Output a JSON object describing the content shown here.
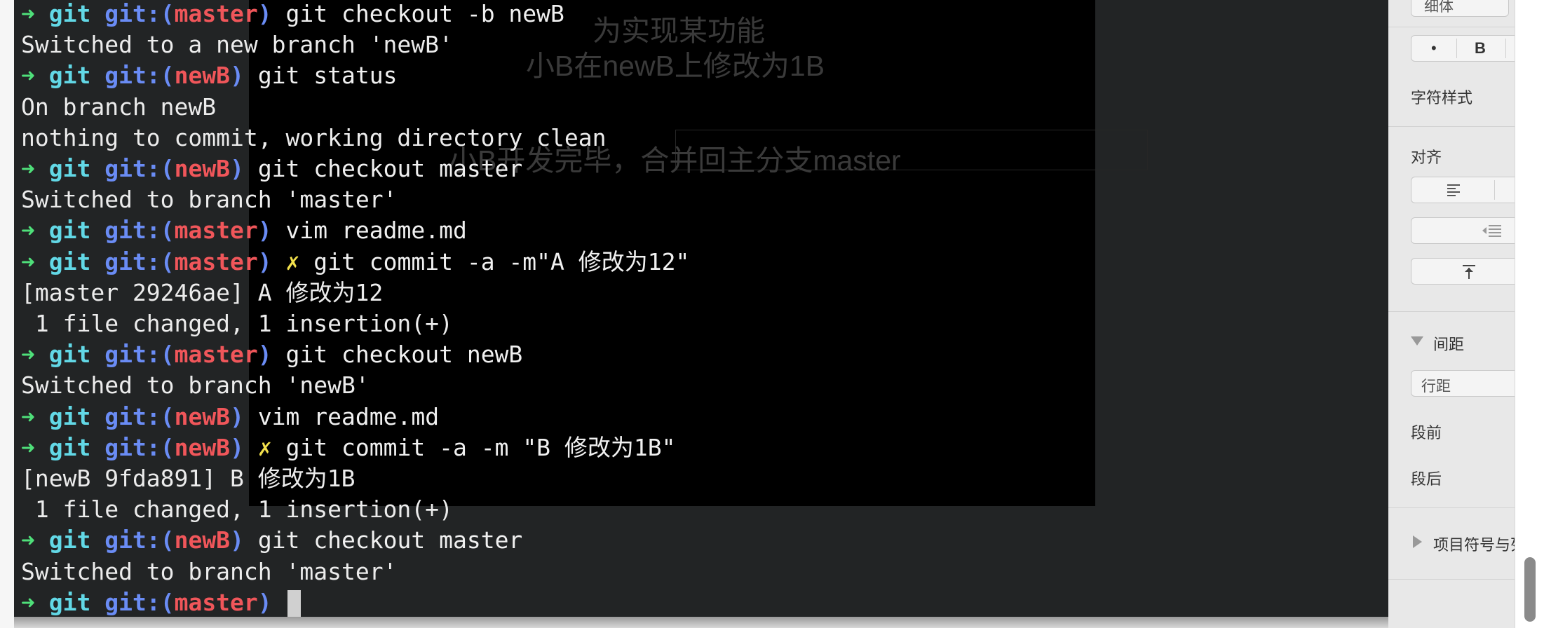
{
  "terminal": {
    "prompt_arrow": "➜",
    "prompt_dir": "git",
    "prompt_git_prefix": "git:(",
    "prompt_git_suffix": ")",
    "dirty_mark": "✗",
    "lines": [
      {
        "kind": "prompt",
        "branch": "master",
        "dirty": false,
        "command": "git checkout -b newB"
      },
      {
        "kind": "output",
        "text": "Switched to a new branch 'newB'"
      },
      {
        "kind": "prompt",
        "branch": "newB",
        "dirty": false,
        "command": "git status"
      },
      {
        "kind": "output",
        "text": "On branch newB"
      },
      {
        "kind": "output",
        "text": "nothing to commit, working directory clean"
      },
      {
        "kind": "prompt",
        "branch": "newB",
        "dirty": false,
        "command": "git checkout master"
      },
      {
        "kind": "output",
        "text": "Switched to branch 'master'"
      },
      {
        "kind": "prompt",
        "branch": "master",
        "dirty": false,
        "command": "vim readme.md"
      },
      {
        "kind": "prompt",
        "branch": "master",
        "dirty": true,
        "command": "git commit -a -m\"A 修改为12\""
      },
      {
        "kind": "output",
        "text": "[master 29246ae] A 修改为12"
      },
      {
        "kind": "output",
        "text": " 1 file changed, 1 insertion(+)"
      },
      {
        "kind": "prompt",
        "branch": "master",
        "dirty": false,
        "command": "git checkout newB"
      },
      {
        "kind": "output",
        "text": "Switched to branch 'newB'"
      },
      {
        "kind": "prompt",
        "branch": "newB",
        "dirty": false,
        "command": "vim readme.md"
      },
      {
        "kind": "prompt",
        "branch": "newB",
        "dirty": true,
        "command": "git commit -a -m \"B 修改为1B\""
      },
      {
        "kind": "output",
        "text": "[newB 9fda891] B 修改为1B"
      },
      {
        "kind": "output",
        "text": " 1 file changed, 1 insertion(+)"
      },
      {
        "kind": "prompt",
        "branch": "newB",
        "dirty": false,
        "command": "git checkout master"
      },
      {
        "kind": "output",
        "text": "Switched to branch 'master'"
      },
      {
        "kind": "prompt",
        "branch": "master",
        "dirty": false,
        "command": "",
        "cursor": true
      }
    ]
  },
  "background_doc": {
    "line1": "为实现某功能",
    "line2": "小B在newB上修改为1B",
    "line3": "小B开发完毕，合并回主分支master"
  },
  "inspector": {
    "font_weight_value": "细体",
    "style_bullet": "•",
    "style_bold": "B",
    "char_style_label": "字符样式",
    "align_label": "对齐",
    "spacing_label": "间距",
    "line_spacing_value": "行距",
    "before_para_label": "段前",
    "after_para_label": "段后",
    "bullets_label": "项目符号与列表"
  },
  "colors": {
    "terminal_bg": "#222425",
    "arrow": "#4fe07a",
    "dir": "#62d8e6",
    "git_prefix": "#6a8cf5",
    "branch": "#f0565a",
    "dirty": "#f2e04c"
  }
}
